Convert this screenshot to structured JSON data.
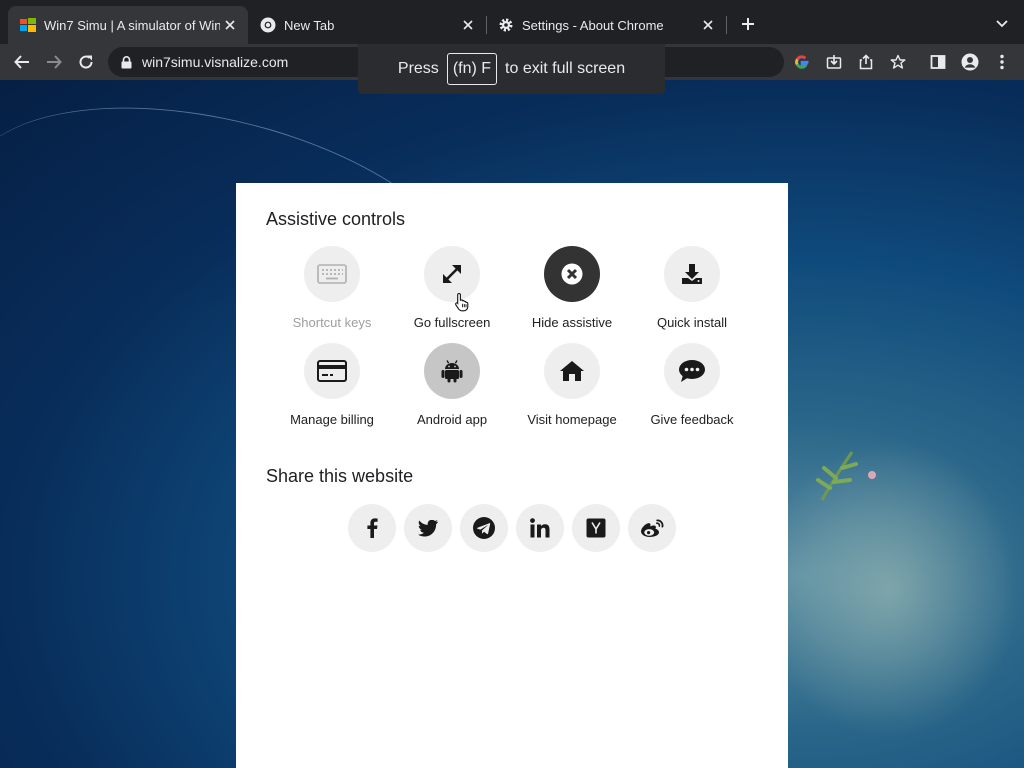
{
  "tabs": [
    {
      "title": "Win7 Simu | A simulator of Win",
      "icon": "windows-favicon",
      "active": true
    },
    {
      "title": "New Tab",
      "icon": "chrome-icon",
      "active": false
    },
    {
      "title": "Settings - About Chrome",
      "icon": "gear-icon",
      "active": false
    }
  ],
  "toolbar": {
    "url": "win7simu.visnalize.com"
  },
  "fullscreen_toast": {
    "prefix": "Press",
    "key": "(fn) F",
    "suffix": "to exit full screen"
  },
  "panel": {
    "assistive_title": "Assistive controls",
    "controls": [
      {
        "label": "Shortcut keys",
        "icon": "keyboard-icon"
      },
      {
        "label": "Go fullscreen",
        "icon": "expand-icon"
      },
      {
        "label": "Hide assistive",
        "icon": "close-circle-icon"
      },
      {
        "label": "Quick install",
        "icon": "download-icon"
      },
      {
        "label": "Manage billing",
        "icon": "credit-card-icon"
      },
      {
        "label": "Android app",
        "icon": "android-icon"
      },
      {
        "label": "Visit homepage",
        "icon": "home-icon"
      },
      {
        "label": "Give feedback",
        "icon": "chat-bubble-icon"
      }
    ],
    "share_title": "Share this website",
    "share": [
      "facebook-icon",
      "twitter-icon",
      "telegram-icon",
      "linkedin-icon",
      "hacker-news-icon",
      "weibo-icon"
    ]
  },
  "colors": {
    "chrome_frame": "#202124",
    "toolbar": "#35363a",
    "panel": "#ffffff",
    "hide_button": "#333333"
  }
}
